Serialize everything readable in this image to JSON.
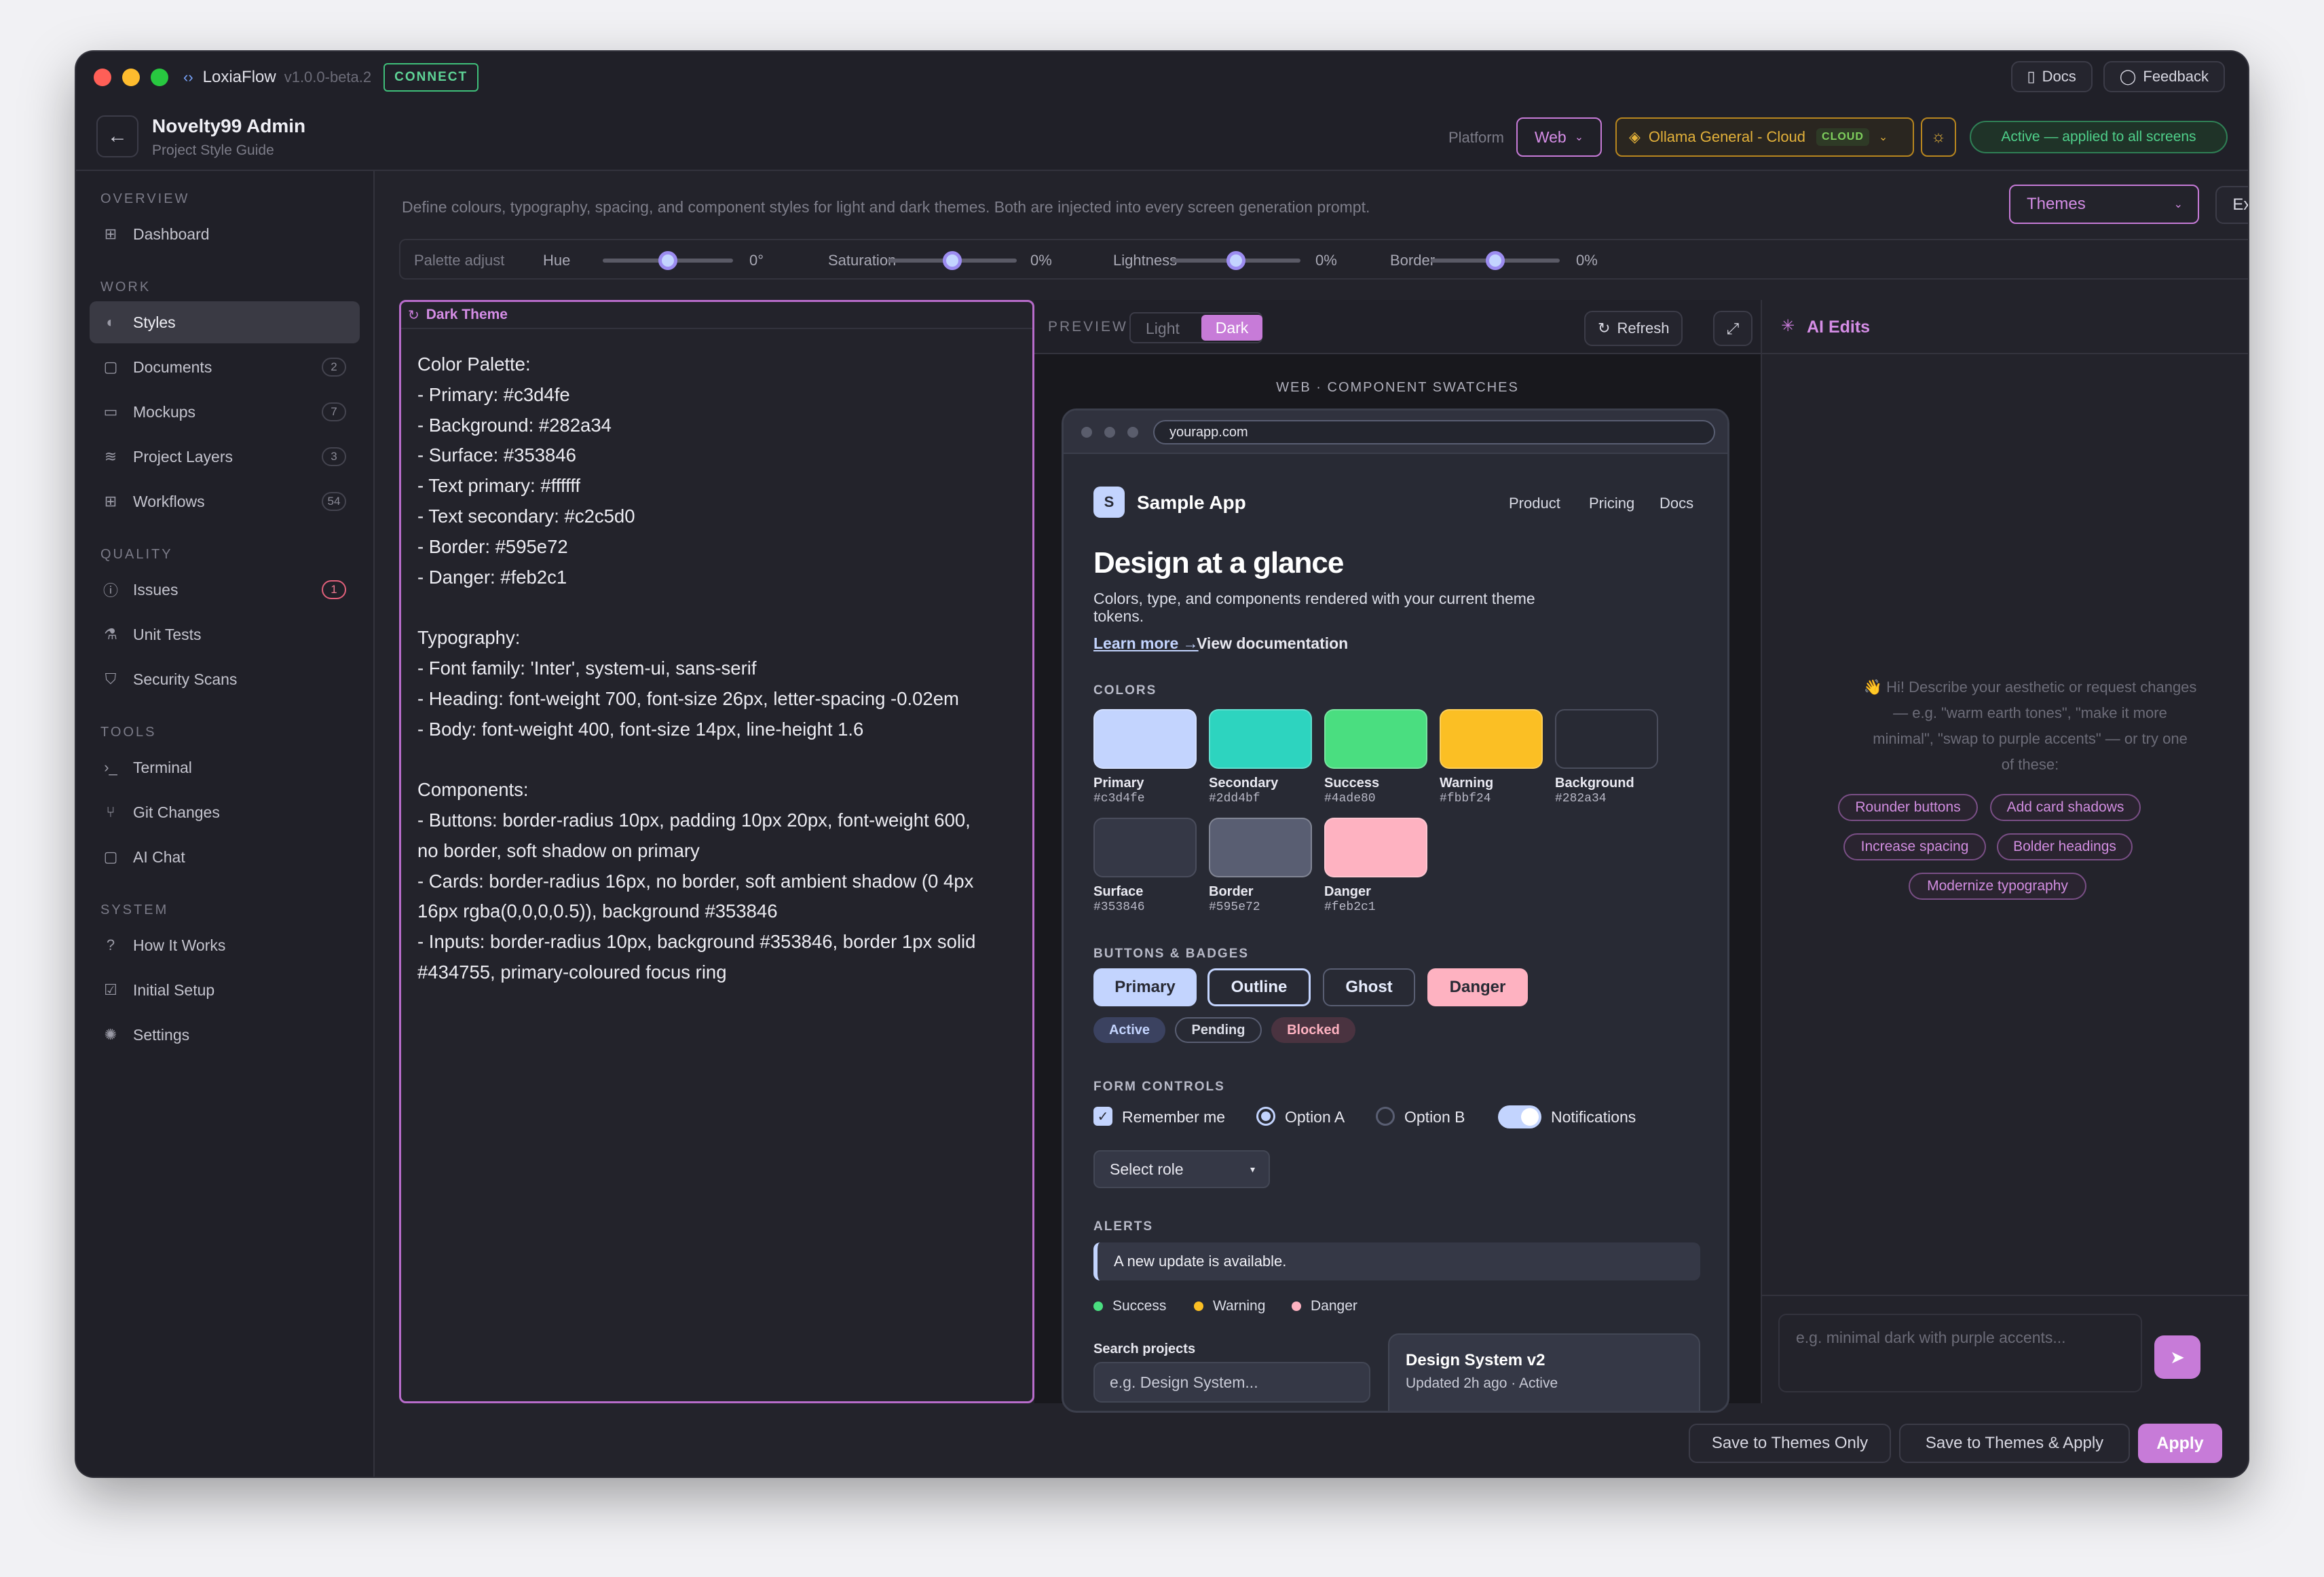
{
  "app": {
    "name": "LoxiaFlow",
    "version": "v1.0.0-beta.2",
    "connect": "CONNECT",
    "docs": "Docs",
    "feedback": "Feedback"
  },
  "project": {
    "title": "Novelty99 Admin",
    "subtitle": "Project Style Guide"
  },
  "header": {
    "platform_label": "Platform",
    "platform_value": "Web",
    "model": "Ollama General - Cloud",
    "model_badge": "CLOUD",
    "active_status": "Active — applied to all screens"
  },
  "sidebar": {
    "sections": [
      "OVERVIEW",
      "WORK",
      "QUALITY",
      "TOOLS",
      "SYSTEM"
    ],
    "items": [
      {
        "label": "Dashboard",
        "icon": "grid-icon"
      },
      {
        "label": "Styles",
        "icon": "palette-icon",
        "active": true
      },
      {
        "label": "Documents",
        "icon": "document-icon",
        "count": "2"
      },
      {
        "label": "Mockups",
        "icon": "monitor-icon",
        "count": "7"
      },
      {
        "label": "Project Layers",
        "icon": "layers-icon",
        "count": "3"
      },
      {
        "label": "Workflows",
        "icon": "workflow-icon",
        "count": "54"
      },
      {
        "label": "Issues",
        "icon": "alert-circle-icon",
        "count": "1"
      },
      {
        "label": "Unit Tests",
        "icon": "flask-icon"
      },
      {
        "label": "Security Scans",
        "icon": "shield-icon"
      },
      {
        "label": "Terminal",
        "icon": "terminal-icon"
      },
      {
        "label": "Git Changes",
        "icon": "git-branch-icon"
      },
      {
        "label": "AI Chat",
        "icon": "chat-icon"
      },
      {
        "label": "How It Works",
        "icon": "help-icon"
      },
      {
        "label": "Initial Setup",
        "icon": "checklist-icon"
      },
      {
        "label": "Settings",
        "icon": "gear-icon"
      }
    ]
  },
  "main": {
    "description": "Define colours, typography, spacing, and component styles for light and dark themes. Both are injected into every screen generation prompt.",
    "themes_select": "Themes",
    "export": "Export",
    "palette": {
      "label": "Palette adjust",
      "sliders": [
        {
          "name": "Hue",
          "value": "0°",
          "level": 0.5
        },
        {
          "name": "Saturation",
          "value": "0%",
          "level": 0.5
        },
        {
          "name": "Lightness",
          "value": "0%",
          "level": 0.5
        },
        {
          "name": "Border",
          "value": "0%",
          "level": 0.5
        }
      ]
    }
  },
  "editor": {
    "title": "Dark Theme",
    "lines": [
      "Color Palette:",
      "- Primary: #c3d4fe",
      "- Background: #282a34",
      "- Surface: #353846",
      "- Text primary: #ffffff",
      "- Text secondary: #c2c5d0",
      "- Border: #595e72",
      "- Danger: #feb2c1",
      "",
      "Typography:",
      "- Font family: 'Inter', system-ui, sans-serif",
      "- Heading: font-weight 700, font-size 26px, letter-spacing -0.02em",
      "- Body: font-weight 400, font-size 14px, line-height 1.6",
      "",
      "Components:",
      "- Buttons: border-radius 10px, padding 10px 20px, font-weight 600,",
      "no border, soft shadow on primary",
      "- Cards: border-radius 16px, no border, soft ambient shadow (0 4px",
      "16px rgba(0,0,0,0.5)), background #353846",
      "- Inputs: border-radius 10px, background #353846, border 1px solid",
      "#434755, primary-coloured focus ring"
    ]
  },
  "preview": {
    "label": "PREVIEW",
    "mode_light": "Light",
    "mode_dark": "Dark",
    "refresh": "Refresh",
    "caption": "WEB · COMPONENT SWATCHES",
    "url": "yourapp.com",
    "app_logo": "S",
    "app_name": "Sample App",
    "nav": [
      "Product",
      "Pricing",
      "Docs"
    ],
    "hero_title": "Design at a glance",
    "hero_text_1": "Colors, type, and components rendered with your current theme",
    "hero_text_2": "tokens.",
    "learn_more": "Learn more →",
    "view_docs": "View documentation",
    "colors_label": "COLORS",
    "swatches": [
      {
        "name": "Primary",
        "hex": "#c3d4fe"
      },
      {
        "name": "Secondary",
        "hex": "#2dd4bf"
      },
      {
        "name": "Success",
        "hex": "#4ade80"
      },
      {
        "name": "Warning",
        "hex": "#fbbf24"
      },
      {
        "name": "Background",
        "hex": "#282a34"
      },
      {
        "name": "Surface",
        "hex": "#353846"
      },
      {
        "name": "Border",
        "hex": "#595e72"
      },
      {
        "name": "Danger",
        "hex": "#feb2c1"
      }
    ],
    "buttons_label": "BUTTONS & BADGES",
    "buttons": [
      "Primary",
      "Outline",
      "Ghost",
      "Danger"
    ],
    "badges": [
      "Active",
      "Pending",
      "Blocked"
    ],
    "form_label": "FORM CONTROLS",
    "checkbox": "Remember me",
    "radio_a": "Option A",
    "radio_b": "Option B",
    "toggle": "Notifications",
    "select": "Select role",
    "alerts_label": "ALERTS",
    "alert": "A new update is available.",
    "legend": [
      "Success",
      "Warning",
      "Danger"
    ],
    "search_label": "Search projects",
    "search_placeholder": "e.g. Design System...",
    "card_title": "Design System v2",
    "card_sub": "Updated 2h ago · Active"
  },
  "ai": {
    "title": "AI Edits",
    "intro": [
      "👋 Hi! Describe your aesthetic or request changes",
      "— e.g. \"warm earth tones\", \"make it more",
      "minimal\", \"swap to purple accents\" — or try one",
      "of these:"
    ],
    "chips": [
      "Rounder buttons",
      "Add card shadows",
      "Increase spacing",
      "Bolder headings",
      "Modernize typography"
    ],
    "input_placeholder": "e.g. minimal dark with purple accents..."
  },
  "footer": {
    "save_only": "Save to Themes Only",
    "save_apply": "Save to Themes & Apply",
    "apply": "Apply"
  },
  "colors": {
    "accent": "#c77bd8",
    "accent_fill": "#c77bd8",
    "bg": "#23232b",
    "model_gold": "#d9a52b",
    "active_green": "#3fbf7a"
  }
}
